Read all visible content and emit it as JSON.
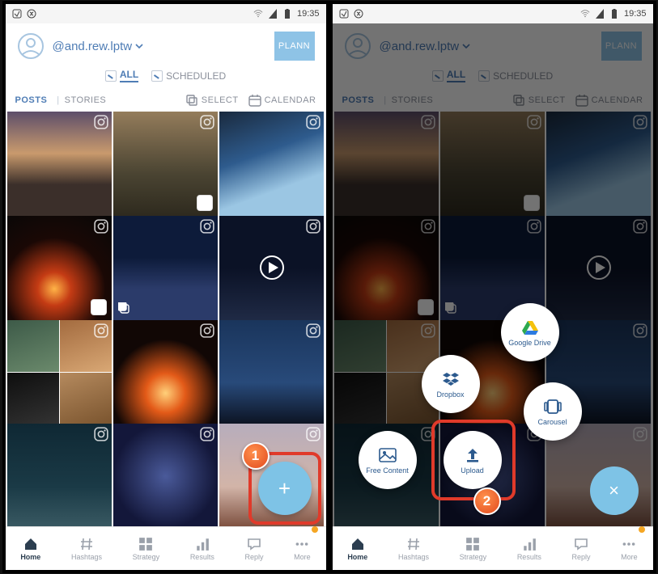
{
  "statusbar": {
    "time": "19:35"
  },
  "user": {
    "handle": "@and.rew.lptw"
  },
  "brand": "PLANN",
  "filters": {
    "all": "ALL",
    "scheduled": "SCHEDULED"
  },
  "tabs": {
    "posts": "POSTS",
    "stories": "STORIES",
    "select": "SELECT",
    "calendar": "CALENDAR"
  },
  "nav": {
    "home": "Home",
    "hashtags": "Hashtags",
    "strategy": "Strategy",
    "results": "Results",
    "reply": "Reply",
    "more": "More"
  },
  "fab_options": {
    "free": "Free Content",
    "upload": "Upload",
    "dropbox": "Dropbox",
    "gdrive": "Google Drive",
    "carousel": "Carousel"
  },
  "markers": {
    "one": "1",
    "two": "2"
  }
}
